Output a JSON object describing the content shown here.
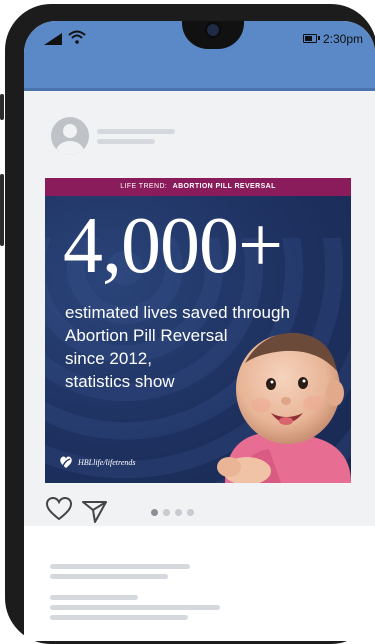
{
  "status_bar": {
    "time": "2:30pm",
    "signal_icon": "signal-icon",
    "wifi_icon": "wifi-icon",
    "battery_icon": "battery-icon"
  },
  "post": {
    "banner_prefix": "LIFE TREND:",
    "banner_highlight": "ABORTION PILL REVERSAL",
    "headline_number": "4,000+",
    "subtitle_lines": [
      "estimated lives saved through",
      "Abortion Pill Reversal",
      "since 2012,",
      "statistics show"
    ],
    "brand_text": "HBLlife/lifetrends",
    "colors": {
      "banner": "#8b1c5c",
      "background": "#1e3160",
      "status_bar": "#5b88c6"
    }
  },
  "actions": {
    "like_icon": "heart-icon",
    "share_icon": "send-icon",
    "carousel": {
      "count": 4,
      "active_index": 0
    }
  }
}
